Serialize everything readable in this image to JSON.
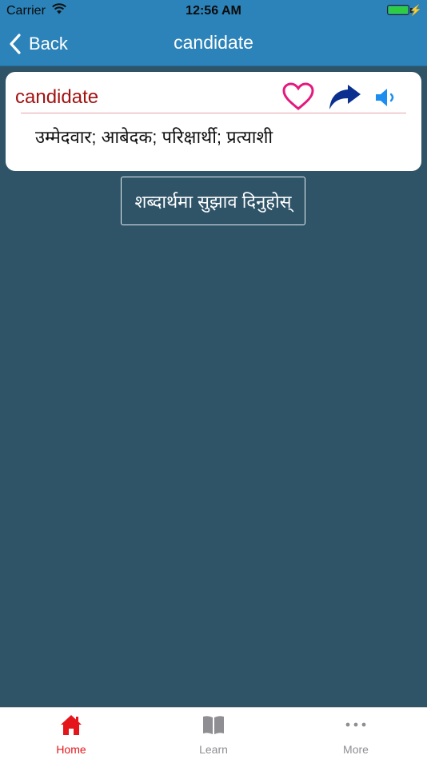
{
  "status": {
    "carrier": "Carrier",
    "time": "12:56 AM",
    "battery_level": 1.0
  },
  "nav": {
    "back_label": "Back",
    "title": "candidate"
  },
  "entry": {
    "word": "candidate",
    "meaning": "उम्मेदवार; आबेदक; परिक्षार्थी; प्रत्याशी"
  },
  "suggest_button": "शब्दार्थमा सुझाव दिनुहोस्",
  "tabs": [
    {
      "label": "Home",
      "icon": "home-icon",
      "active": true
    },
    {
      "label": "Learn",
      "icon": "book-icon",
      "active": false
    },
    {
      "label": "More",
      "icon": "more-icon",
      "active": false
    }
  ],
  "colors": {
    "navbar": "#2b83b9",
    "background": "#2f5468",
    "headword": "#a31212",
    "heart": "#e5197d",
    "share": "#0a2f8f",
    "speaker": "#1d8ef0",
    "active_tab": "#e4161b",
    "inactive_tab": "#8e8e93"
  }
}
